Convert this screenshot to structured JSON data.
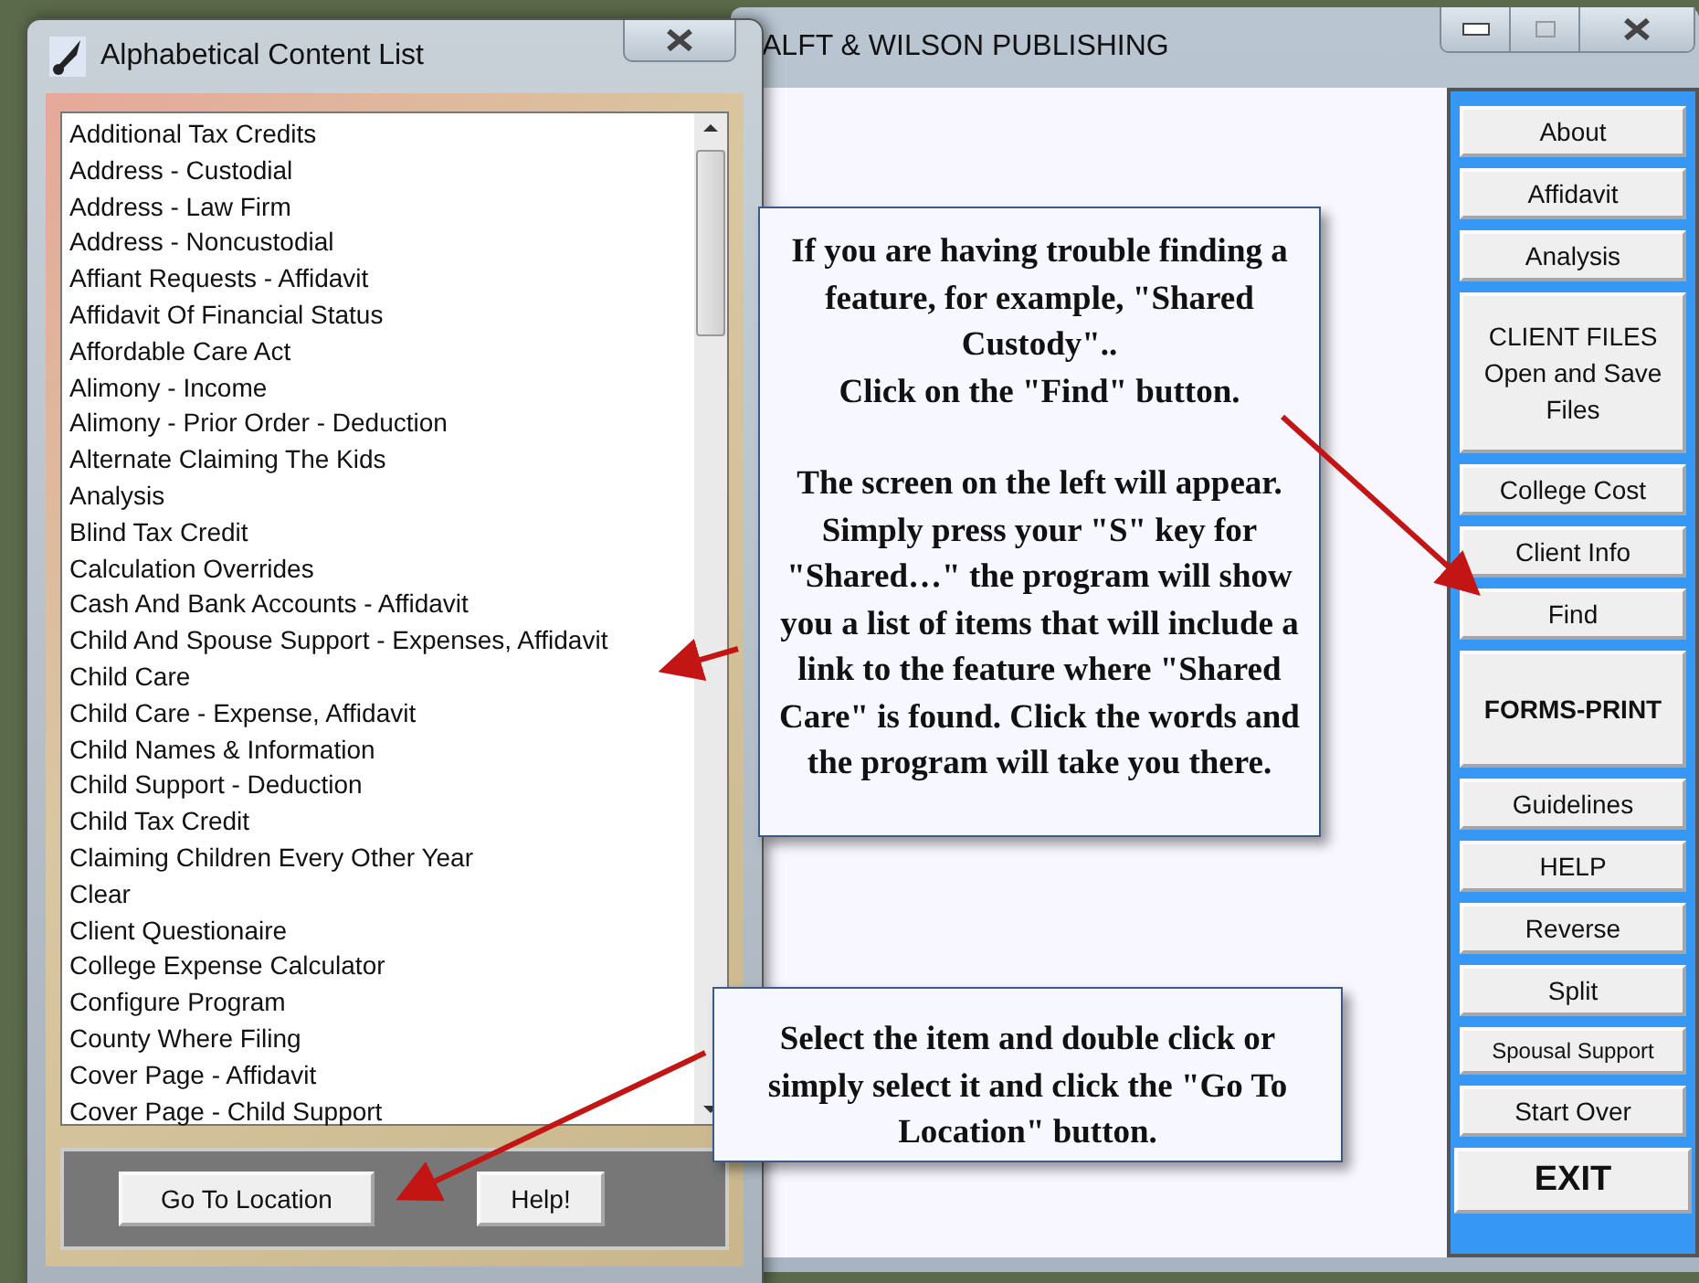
{
  "main_window": {
    "title": "ALFT & WILSON PUBLISHING"
  },
  "dialog": {
    "title": "Alphabetical Content List",
    "items": [
      "Additional Tax Credits",
      "Address - Custodial",
      "Address - Law Firm",
      "Address - Noncustodial",
      "Affiant Requests - Affidavit",
      "Affidavit Of Financial Status",
      "Affordable Care Act",
      "Alimony - Income",
      "Alimony - Prior Order - Deduction",
      "Alternate Claiming The Kids",
      "Analysis",
      "Blind Tax Credit",
      "Calculation Overrides",
      "Cash And Bank Accounts - Affidavit",
      "Child And Spouse Support - Expenses, Affidavit",
      "Child Care",
      "Child Care - Expense, Affidavit",
      "Child Names & Information",
      "Child Support - Deduction",
      "Child Tax Credit",
      "Claiming Children Every Other Year",
      "Clear",
      "Client Questionaire",
      "College Expense Calculator",
      "Configure Program",
      "County Where Filing",
      "Cover Page - Affidavit",
      "Cover Page - Child Support"
    ],
    "buttons": [
      "Go To Location",
      "Help!"
    ]
  },
  "side_buttons": [
    {
      "label": "About",
      "kind": "plain"
    },
    {
      "label": "Affidavit",
      "kind": "plain"
    },
    {
      "label": "Analysis",
      "kind": "plain"
    },
    {
      "label": "CLIENT FILES Open and Save Files",
      "kind": "tall"
    },
    {
      "label": "College Cost",
      "kind": "plain"
    },
    {
      "label": "Client Info",
      "kind": "plain"
    },
    {
      "label": "Find",
      "kind": "plain"
    },
    {
      "label": "FORMS-PRINT",
      "kind": "bold"
    },
    {
      "label": "Guidelines",
      "kind": "plain"
    },
    {
      "label": "HELP",
      "kind": "plain"
    },
    {
      "label": "Reverse",
      "kind": "plain"
    },
    {
      "label": "Split",
      "kind": "plain"
    },
    {
      "label": "Spousal Support",
      "kind": "small"
    },
    {
      "label": "Start Over",
      "kind": "plain"
    },
    {
      "label": "EXIT",
      "kind": "exit"
    }
  ],
  "callouts": [
    {
      "paragraphs": [
        "If you are having trouble finding a feature, for example,  \"Shared Custody\"..",
        "Click on the \"Find\" button.",
        "The screen on the left will appear. Simply press your \"S\" key for \"Shared…\" the program will show you a list of items that will include a link to the feature where \"Shared Care\" is found. Click the words and the program will take you there."
      ]
    },
    {
      "paragraphs": [
        "Select the item and double click or simply select it and click the \"Go To Location\" button."
      ]
    }
  ]
}
